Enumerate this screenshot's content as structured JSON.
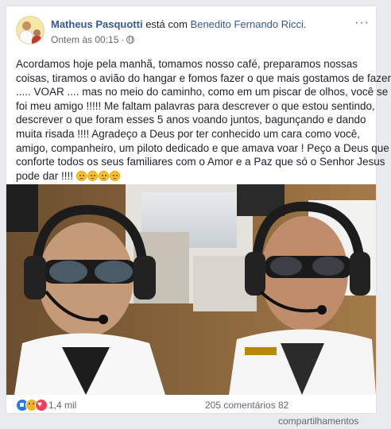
{
  "post": {
    "author": "Matheus Pasquotti",
    "with_text": " está com ",
    "tagged": "Benedito Fernando Ricci.",
    "time": "Ontem às 00:15",
    "separator": "·",
    "privacy_icon": "globe-icon",
    "more_label": "···",
    "text_lines": [
      "Acordamos hoje pela manhã, tomamos nosso café, preparamos nossas",
      "coisas, tiramos o avião do hangar e fomos fazer o que mais gostamos de fazer",
      "..... VOAR .... mas no meio do caminho, como em um piscar de olhos, você se",
      "foi meu amigo !!!!! Me faltam palavras para descrever o que estou sentindo,",
      "descrever o que foram esses 5 anos voando juntos, bagunçando e dando",
      "muita risada !!!! Agradeço a Deus por ter conhecido um cara como você,",
      "amigo, companheiro, um piloto dedicado e que amava voar ! Peço a Deus que",
      "conforte todos os seus familiares com o Amor e a Paz que só o Senhor Jesus",
      "pode dar !!!! "
    ],
    "emoji_icon": "crying-face-emoji"
  },
  "photo": {
    "description_icon": "cockpit-photo"
  },
  "footer": {
    "reaction_icons": [
      "like-reaction-icon",
      "sad-reaction-icon",
      "love-reaction-icon"
    ],
    "reaction_count": "1,4 mil",
    "comments": "205 comentários",
    "shares": "82 compartilhamentos"
  },
  "colors": {
    "link": "#365899",
    "text": "#1d2129",
    "meta": "#616770",
    "like": "#2078f4",
    "sad": "#f7b125",
    "love": "#f33e58"
  }
}
